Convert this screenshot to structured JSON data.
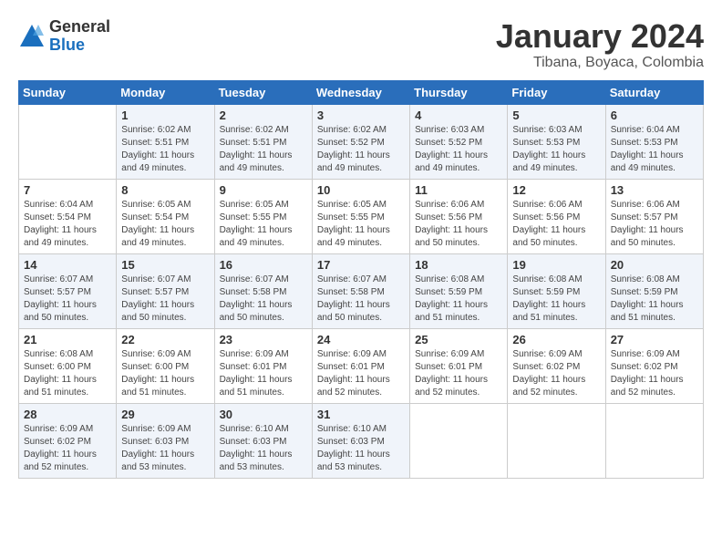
{
  "logo": {
    "general": "General",
    "blue": "Blue"
  },
  "header": {
    "title": "January 2024",
    "subtitle": "Tibana, Boyaca, Colombia"
  },
  "weekdays": [
    "Sunday",
    "Monday",
    "Tuesday",
    "Wednesday",
    "Thursday",
    "Friday",
    "Saturday"
  ],
  "weeks": [
    [
      {
        "day": "",
        "info": ""
      },
      {
        "day": "1",
        "info": "Sunrise: 6:02 AM\nSunset: 5:51 PM\nDaylight: 11 hours and 49 minutes."
      },
      {
        "day": "2",
        "info": "Sunrise: 6:02 AM\nSunset: 5:51 PM\nDaylight: 11 hours and 49 minutes."
      },
      {
        "day": "3",
        "info": "Sunrise: 6:02 AM\nSunset: 5:52 PM\nDaylight: 11 hours and 49 minutes."
      },
      {
        "day": "4",
        "info": "Sunrise: 6:03 AM\nSunset: 5:52 PM\nDaylight: 11 hours and 49 minutes."
      },
      {
        "day": "5",
        "info": "Sunrise: 6:03 AM\nSunset: 5:53 PM\nDaylight: 11 hours and 49 minutes."
      },
      {
        "day": "6",
        "info": "Sunrise: 6:04 AM\nSunset: 5:53 PM\nDaylight: 11 hours and 49 minutes."
      }
    ],
    [
      {
        "day": "7",
        "info": "Sunrise: 6:04 AM\nSunset: 5:54 PM\nDaylight: 11 hours and 49 minutes."
      },
      {
        "day": "8",
        "info": "Sunrise: 6:05 AM\nSunset: 5:54 PM\nDaylight: 11 hours and 49 minutes."
      },
      {
        "day": "9",
        "info": "Sunrise: 6:05 AM\nSunset: 5:55 PM\nDaylight: 11 hours and 49 minutes."
      },
      {
        "day": "10",
        "info": "Sunrise: 6:05 AM\nSunset: 5:55 PM\nDaylight: 11 hours and 49 minutes."
      },
      {
        "day": "11",
        "info": "Sunrise: 6:06 AM\nSunset: 5:56 PM\nDaylight: 11 hours and 50 minutes."
      },
      {
        "day": "12",
        "info": "Sunrise: 6:06 AM\nSunset: 5:56 PM\nDaylight: 11 hours and 50 minutes."
      },
      {
        "day": "13",
        "info": "Sunrise: 6:06 AM\nSunset: 5:57 PM\nDaylight: 11 hours and 50 minutes."
      }
    ],
    [
      {
        "day": "14",
        "info": "Sunrise: 6:07 AM\nSunset: 5:57 PM\nDaylight: 11 hours and 50 minutes."
      },
      {
        "day": "15",
        "info": "Sunrise: 6:07 AM\nSunset: 5:57 PM\nDaylight: 11 hours and 50 minutes."
      },
      {
        "day": "16",
        "info": "Sunrise: 6:07 AM\nSunset: 5:58 PM\nDaylight: 11 hours and 50 minutes."
      },
      {
        "day": "17",
        "info": "Sunrise: 6:07 AM\nSunset: 5:58 PM\nDaylight: 11 hours and 50 minutes."
      },
      {
        "day": "18",
        "info": "Sunrise: 6:08 AM\nSunset: 5:59 PM\nDaylight: 11 hours and 51 minutes."
      },
      {
        "day": "19",
        "info": "Sunrise: 6:08 AM\nSunset: 5:59 PM\nDaylight: 11 hours and 51 minutes."
      },
      {
        "day": "20",
        "info": "Sunrise: 6:08 AM\nSunset: 5:59 PM\nDaylight: 11 hours and 51 minutes."
      }
    ],
    [
      {
        "day": "21",
        "info": "Sunrise: 6:08 AM\nSunset: 6:00 PM\nDaylight: 11 hours and 51 minutes."
      },
      {
        "day": "22",
        "info": "Sunrise: 6:09 AM\nSunset: 6:00 PM\nDaylight: 11 hours and 51 minutes."
      },
      {
        "day": "23",
        "info": "Sunrise: 6:09 AM\nSunset: 6:01 PM\nDaylight: 11 hours and 51 minutes."
      },
      {
        "day": "24",
        "info": "Sunrise: 6:09 AM\nSunset: 6:01 PM\nDaylight: 11 hours and 52 minutes."
      },
      {
        "day": "25",
        "info": "Sunrise: 6:09 AM\nSunset: 6:01 PM\nDaylight: 11 hours and 52 minutes."
      },
      {
        "day": "26",
        "info": "Sunrise: 6:09 AM\nSunset: 6:02 PM\nDaylight: 11 hours and 52 minutes."
      },
      {
        "day": "27",
        "info": "Sunrise: 6:09 AM\nSunset: 6:02 PM\nDaylight: 11 hours and 52 minutes."
      }
    ],
    [
      {
        "day": "28",
        "info": "Sunrise: 6:09 AM\nSunset: 6:02 PM\nDaylight: 11 hours and 52 minutes."
      },
      {
        "day": "29",
        "info": "Sunrise: 6:09 AM\nSunset: 6:03 PM\nDaylight: 11 hours and 53 minutes."
      },
      {
        "day": "30",
        "info": "Sunrise: 6:10 AM\nSunset: 6:03 PM\nDaylight: 11 hours and 53 minutes."
      },
      {
        "day": "31",
        "info": "Sunrise: 6:10 AM\nSunset: 6:03 PM\nDaylight: 11 hours and 53 minutes."
      },
      {
        "day": "",
        "info": ""
      },
      {
        "day": "",
        "info": ""
      },
      {
        "day": "",
        "info": ""
      }
    ]
  ]
}
